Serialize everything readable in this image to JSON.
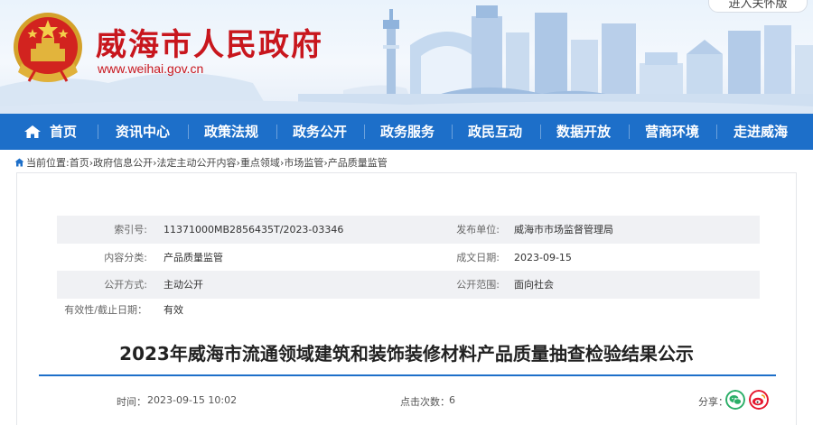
{
  "header": {
    "site_title": "威海市人民政府",
    "site_url": "www.weihai.gov.cn",
    "care_mode_button": "进入关怀版"
  },
  "nav": {
    "home_label": "首页",
    "items": [
      "资讯中心",
      "政策法规",
      "政务公开",
      "政务服务",
      "政民互动",
      "数据开放",
      "营商环境",
      "走进威海"
    ]
  },
  "breadcrumb": {
    "prefix": "当前位置",
    "items": [
      "首页",
      "政府信息公开",
      "法定主动公开内容",
      "重点领域",
      "市场监管",
      "产品质量监管"
    ]
  },
  "meta": {
    "index_label": "索引号:",
    "index_value": "11371000MB2856435T/2023-03346",
    "publisher_label": "发布单位:",
    "publisher_value": "威海市市场监督管理局",
    "category_label": "内容分类:",
    "category_value": "产品质量监管",
    "date_label": "成文日期:",
    "date_value": "2023-09-15",
    "method_label": "公开方式:",
    "method_value": "主动公开",
    "scope_label": "公开范围:",
    "scope_value": "面向社会",
    "validity_label": "有效性/截止日期：",
    "validity_value": "有效"
  },
  "article": {
    "title": "2023年威海市流通领域建筑和装饰装修材料产品质量抽查检验结果公示",
    "time_label": "时间：",
    "time_value": "2023-09-15 10:02",
    "clicks_label": "点击次数：",
    "clicks_value": "6",
    "share_label": "分享："
  },
  "colors": {
    "nav_blue": "#1d6fc9",
    "title_red": "#c8161d",
    "wechat_green": "#2aae67",
    "weibo_red": "#e6162d"
  }
}
